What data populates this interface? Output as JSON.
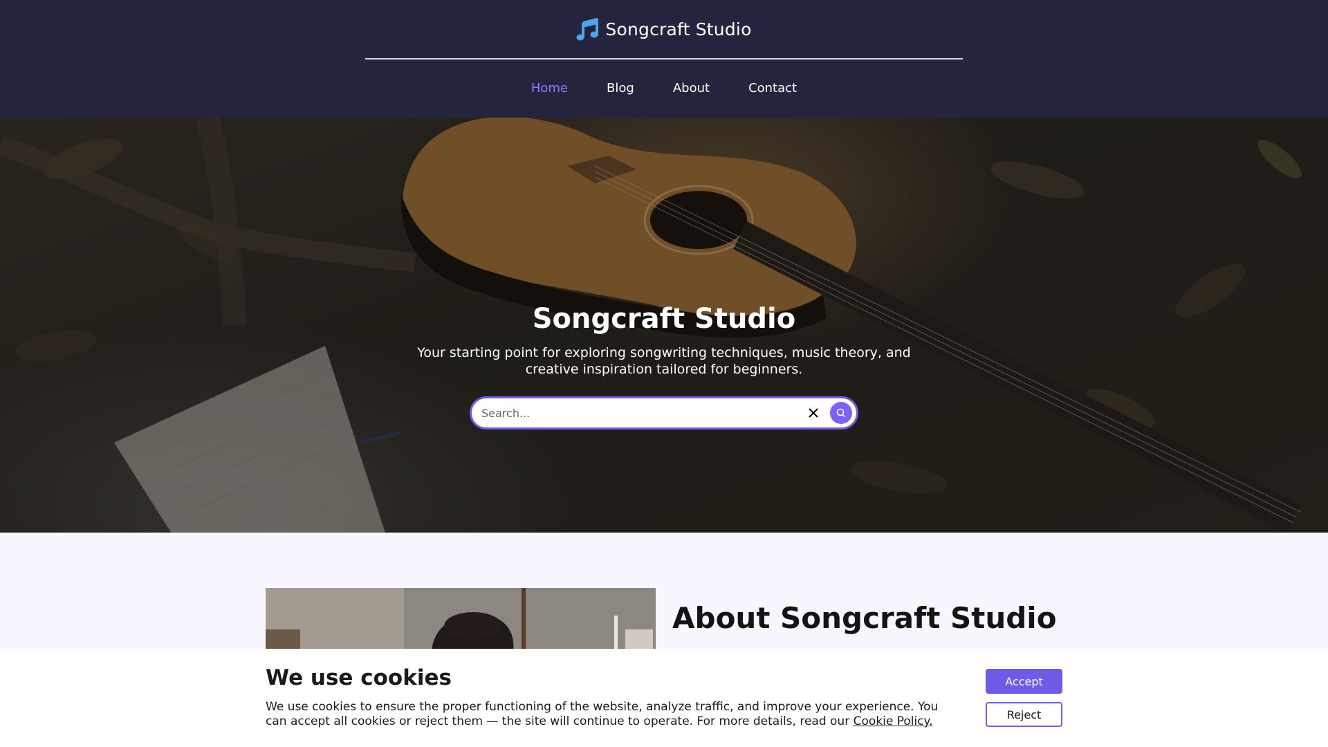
{
  "header": {
    "brand_icon": "music-note-icon",
    "brand_name": "Songcraft Studio",
    "nav": [
      {
        "label": "Home",
        "active": true
      },
      {
        "label": "Blog",
        "active": false
      },
      {
        "label": "About",
        "active": false
      },
      {
        "label": "Contact",
        "active": false
      }
    ]
  },
  "hero": {
    "title": "Songcraft Studio",
    "subtitle": "Your starting point for exploring songwriting techniques, music theory, and creative inspiration tailored for beginners.",
    "search": {
      "placeholder": "Search...",
      "value": "",
      "clear_icon": "close-icon",
      "submit_icon": "search-icon"
    }
  },
  "about": {
    "title": "About Songcraft Studio"
  },
  "cookie_banner": {
    "title": "We use cookies",
    "text": "We use cookies to ensure the proper functioning of the website, analyze traffic, and improve your experience. You can accept all cookies or reject them — the site will continue to operate. For more details, read our",
    "link_text": "Cookie Policy.",
    "accept_label": "Accept",
    "reject_label": "Reject"
  },
  "colors": {
    "header_bg": "#25243f",
    "accent": "#6c5ce7",
    "nav_active": "#8f7bff",
    "brand_icon": "#4fa3e8"
  }
}
